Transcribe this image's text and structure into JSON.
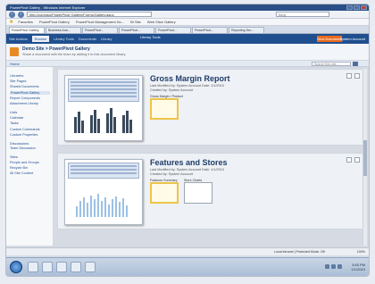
{
  "window": {
    "title": "PowerPivot Gallery - Windows Internet Explorer"
  },
  "address": {
    "url": "http://contoso/PowerPivot Gallery/Forms/Gallery.aspx",
    "search_placeholder": "Bing"
  },
  "favorites": [
    "Favorites",
    "PowerPivot Gallery",
    "PowerPivot Management Ho...",
    "BI Site",
    "Web Slice Gallery"
  ],
  "tabs": [
    "PowerPivot Gallery",
    "Business Ana...",
    "PowerPivot...",
    "PowerPivot...",
    "PowerPivot...",
    "PowerPivot...",
    "Reporting Ser..."
  ],
  "ribbon": {
    "site_actions": "Site Actions",
    "tab_browse": "Browse",
    "tab_library": "Library Tools",
    "tab_documents": "Documents",
    "tab_library2": "Library",
    "center_label": "Library Tools",
    "publish": "New Document",
    "user": "System Account"
  },
  "site": {
    "title": "Demo Site > PowerPivot Gallery",
    "description": "Share a document with the team by adding it to this document library."
  },
  "tools": {
    "home": "Home",
    "search_placeholder": "Search this site..."
  },
  "nav": {
    "libraries_head": "Libraries",
    "libraries": [
      "Site Pages",
      "Shared Documents",
      "PowerPivot Gallery",
      "Report Components",
      "Attachment Library"
    ],
    "lists_head": "Lists",
    "lists": [
      "Calendar",
      "Tasks",
      "Custom Commands",
      "Custom Properties"
    ],
    "discussions_head": "Discussions",
    "discussions": [
      "Team Discussion"
    ],
    "sites_head": "Sites",
    "sites": [
      "People and Groups"
    ],
    "recycle": "Recycle Bin",
    "all_content": "All Site Content"
  },
  "cards": [
    {
      "title": "Gross Margin Report",
      "meta1": "Last Modified by: System Account     Date: 1/1/2010",
      "meta2": "Created by: System Account",
      "thumb_label": "Gross Margin / Product"
    },
    {
      "title": "Features and Stores",
      "meta1": "Last Modified by: System Account     Date: 1/1/2010",
      "meta2": "Created by: System Account",
      "thumb_label_1": "Features Summary",
      "thumb_label_2": "Store Charts"
    }
  ],
  "status": {
    "text": "Local intranet | Protected Mode: Off",
    "zoom": "100%"
  },
  "clock": {
    "time": "3:55 PM",
    "date": "1/1/2010"
  },
  "colors": {
    "ribbon": "#1f4f8f",
    "accent": "#e96b1f",
    "titlebar": "#2a4f86"
  }
}
